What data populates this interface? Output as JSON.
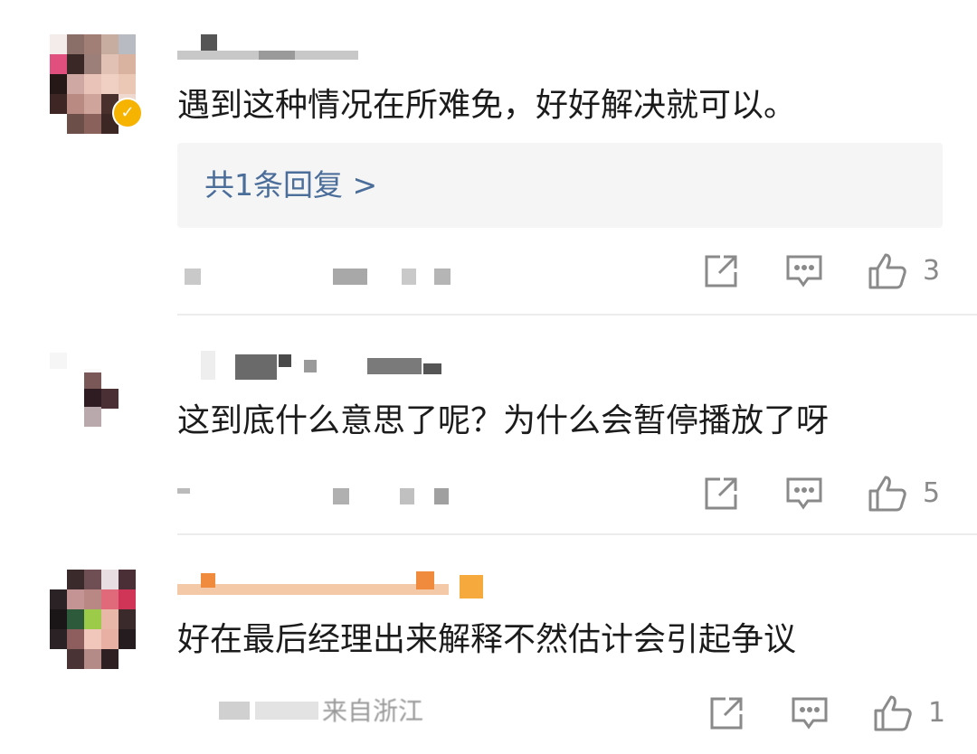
{
  "comments": [
    {
      "text": "遇到这种情况在所难免，好好解决就可以。",
      "reply_link": "共1条回复 >",
      "like_count": "3",
      "verified_icon": "verified-badge-icon"
    },
    {
      "text": "这到底什么意思了呢？为什么会暂停播放了呀",
      "like_count": "5"
    },
    {
      "text": "好在最后经理出来解释不然估计会引起争议",
      "meta_text": "来自浙江",
      "like_count": "1"
    }
  ],
  "icons": {
    "share": "share-icon",
    "reply": "comment-icon",
    "like": "thumbs-up-icon"
  },
  "colors": {
    "reply_link": "#4a6d9a",
    "reply_bg": "#f5f5f5",
    "icon": "#8a8a8a",
    "verified": "#f6b300",
    "username_orange": "#f08a3c"
  }
}
